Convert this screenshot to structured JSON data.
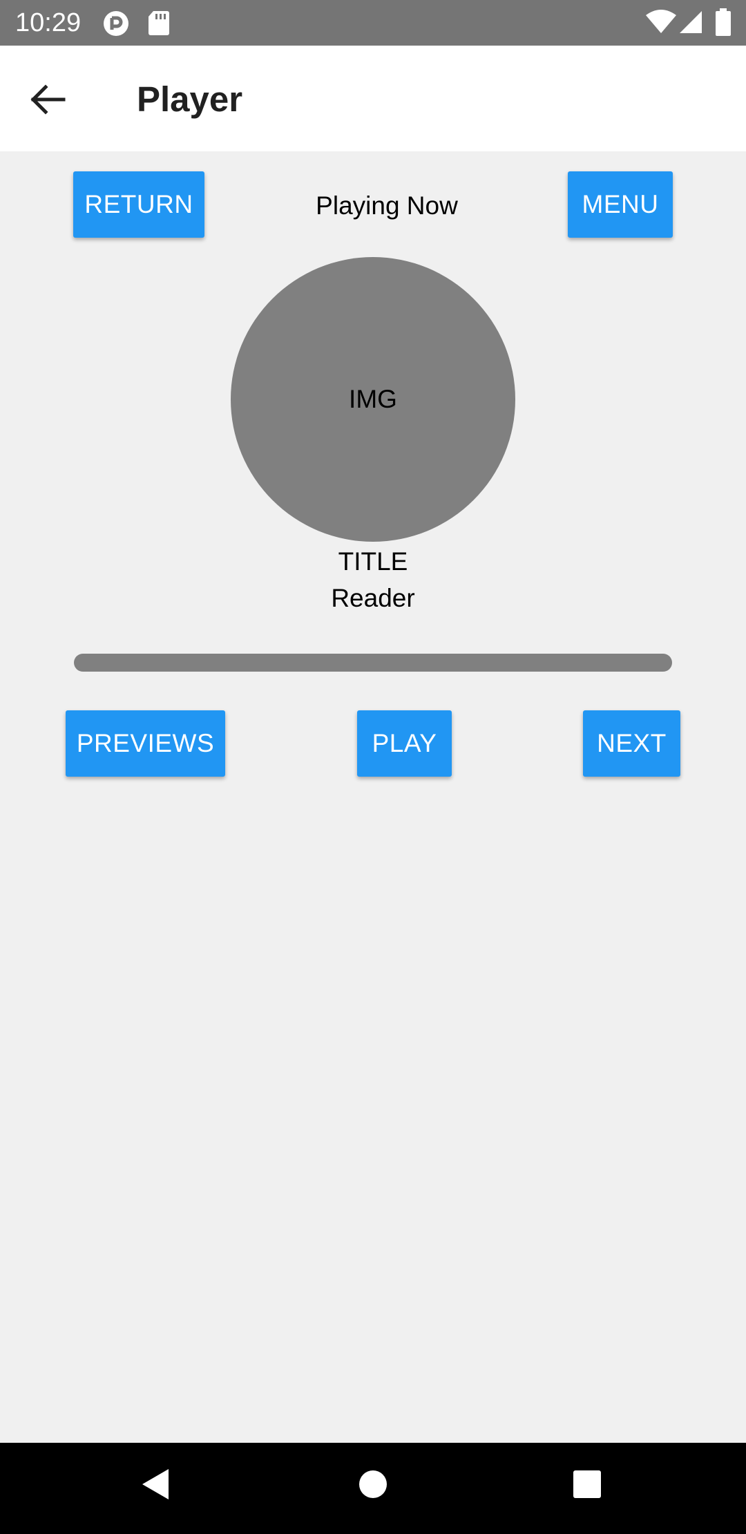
{
  "status_bar": {
    "time": "10:29",
    "left_icons": [
      "signal-app-icon",
      "sd-card-icon"
    ],
    "right_icons": [
      "wifi-icon",
      "cell-signal-icon",
      "battery-icon"
    ]
  },
  "app_bar": {
    "back_icon": "arrow-back-icon",
    "title": "Player"
  },
  "header": {
    "return_label": "RETURN",
    "now_playing": "Playing Now",
    "menu_label": "MENU"
  },
  "cover": {
    "label": "IMG"
  },
  "track": {
    "title": "TITLE",
    "reader": "Reader"
  },
  "progress": {
    "value": 0
  },
  "controls": {
    "previous_label": "PREVIEWS",
    "play_label": "PLAY",
    "next_label": "NEXT"
  },
  "nav_bar": {
    "icons": [
      "back-triangle-icon",
      "home-circle-icon",
      "recents-square-icon"
    ]
  },
  "colors": {
    "status_bar": "#757575",
    "app_bar": "#ffffff",
    "background": "#f0f0f0",
    "button": "#2196f3",
    "cover": "#808080",
    "progress_track": "#808080",
    "nav_bar": "#000000"
  }
}
